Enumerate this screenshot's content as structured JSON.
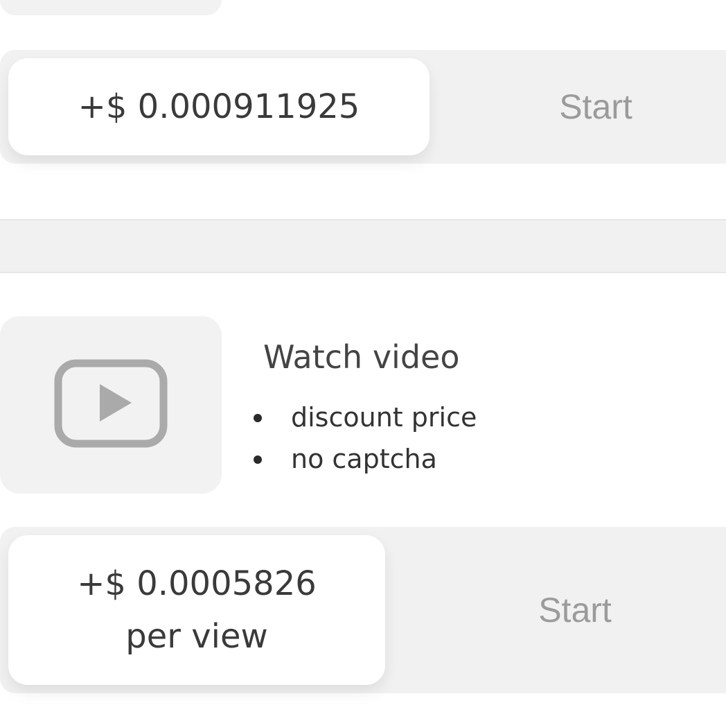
{
  "task_1": {
    "reward": "+$ 0.000911925",
    "start_label": "Start"
  },
  "task_2": {
    "icon": "play-video-icon",
    "title": "Watch video",
    "features": [
      "discount price",
      "no captcha"
    ],
    "reward_line_1": "+$ 0.0005826",
    "reward_line_2": "per view",
    "start_label": "Start"
  },
  "colors": {
    "card_background": "#f1f1f1",
    "price_background": "#ffffff",
    "start_text": "#9b9b9b",
    "icon_gray": "#aaaaaa"
  }
}
